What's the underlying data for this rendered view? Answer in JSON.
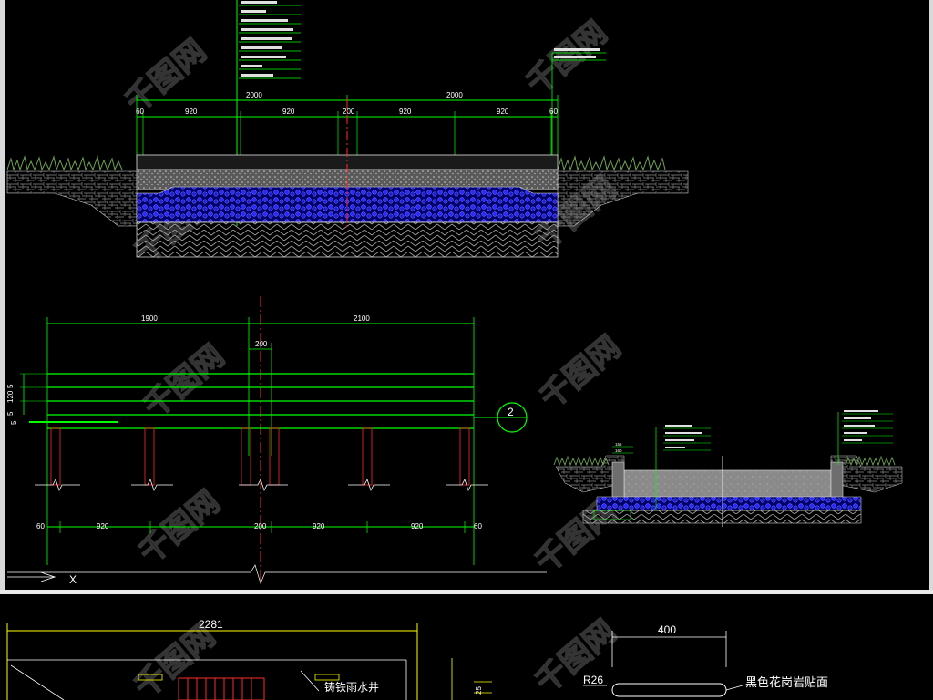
{
  "watermark": {
    "text": "千图网"
  },
  "section_1": {
    "overall_dims": [
      "2000",
      "2000"
    ],
    "segment_dims": [
      "60",
      "920",
      "920",
      "200",
      "920",
      "920",
      "60"
    ],
    "leader_notes": [
      "",
      "",
      "",
      "",
      "",
      "",
      "",
      "",
      ""
    ],
    "right_notes": [
      "",
      ""
    ]
  },
  "elevation": {
    "top_dims": [
      "1900",
      "2100"
    ],
    "center_dim": "200",
    "left_dims": [
      "5",
      "120",
      "5"
    ],
    "left_dim_extra": "5",
    "bottom_dims": [
      "60",
      "920",
      "200",
      "920",
      "920",
      "60"
    ],
    "callout": "2",
    "axis_label": "X"
  },
  "section_2": {
    "small_dims": [
      "155",
      "160"
    ]
  },
  "bottom_panel": {
    "width_dim": "2281",
    "drain_label": "铸铁雨水井",
    "right_dim": "400",
    "radius_label": "R26",
    "material_label": "黑色花岗岩贴面",
    "side_dim": "25"
  },
  "colors": {
    "background": "#000000",
    "dimension_line": "#00ff00",
    "section_line": "#ffffff",
    "gravel": "#1a1aff",
    "axis_red": "#ff2a2a",
    "grass": "#4a7a3a",
    "callout": "#00ff00"
  }
}
